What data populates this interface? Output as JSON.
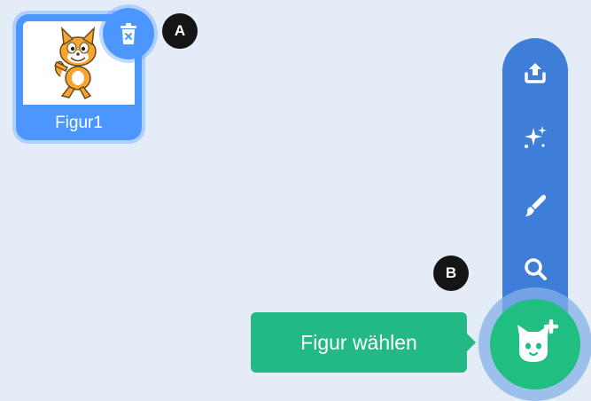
{
  "sprite": {
    "name": "Figur1"
  },
  "markers": {
    "a": "A",
    "b": "B"
  },
  "menu": {
    "items": [
      {
        "icon": "upload-icon"
      },
      {
        "icon": "surprise-sparkle-icon"
      },
      {
        "icon": "paint-brush-icon"
      },
      {
        "icon": "search-icon"
      }
    ]
  },
  "fab": {
    "icon": "cat-plus-icon"
  },
  "tooltip": {
    "label": "Figur wählen"
  },
  "colors": {
    "background": "#e3ecf7",
    "accent_blue": "#4c97ff",
    "menu_blue": "#3f7ed8",
    "fab_green": "#20bf81",
    "tooltip_green": "#22b985",
    "marker_black": "#151515"
  }
}
